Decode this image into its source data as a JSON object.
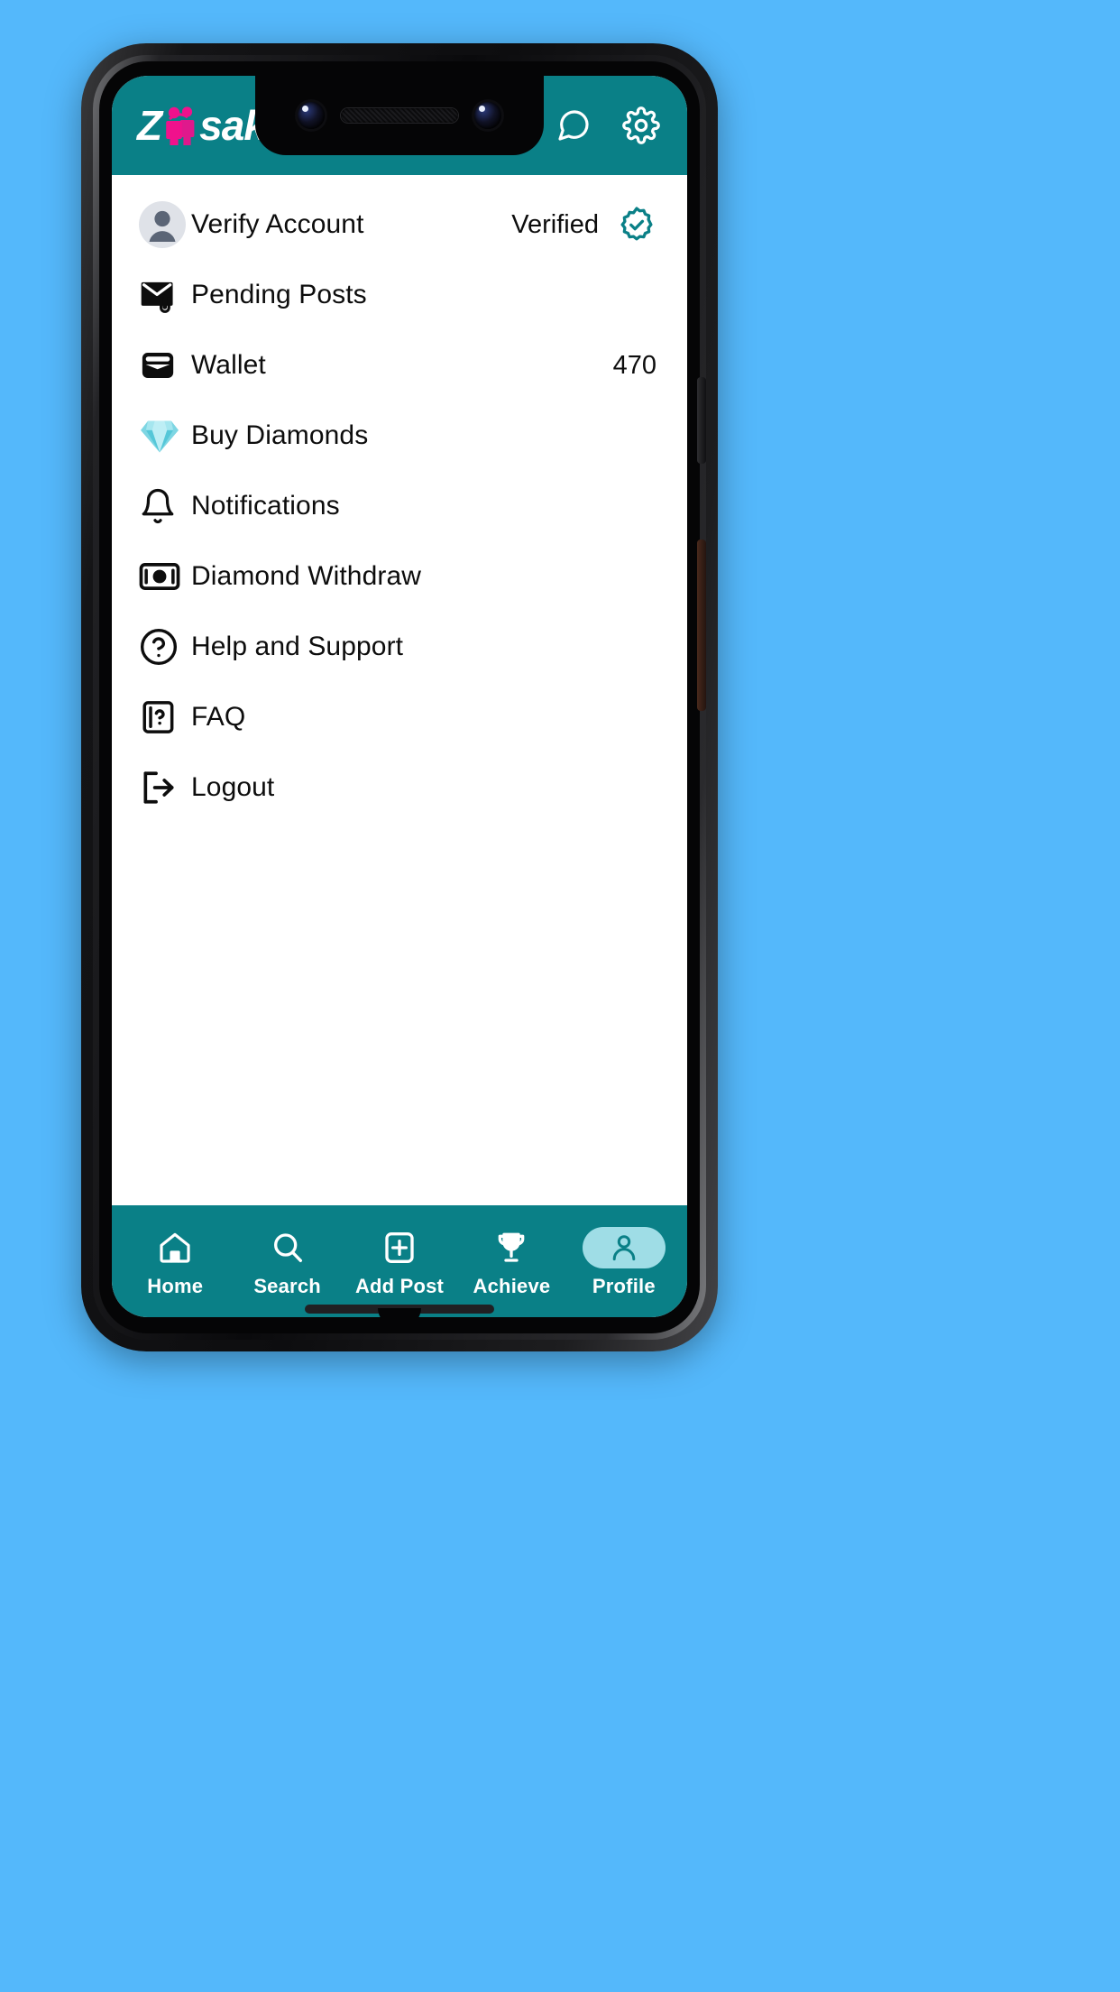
{
  "app": {
    "logo_prefix": "Z",
    "logo_suffix": "sakhi",
    "logo_icon": "couple-icon",
    "brand_teal": "#0a8087",
    "brand_pink": "#f0118c",
    "page_background": "#54b8fb"
  },
  "header": {
    "actions": [
      {
        "name": "notifications-bell-icon",
        "label": "Notifications"
      },
      {
        "name": "chat-bubble-icon",
        "label": "Messages"
      },
      {
        "name": "gear-icon",
        "label": "Settings"
      }
    ]
  },
  "menu": {
    "items": [
      {
        "icon": "avatar",
        "label": "Verify Account",
        "trailing_text": "Verified",
        "trailing_icon": "verified-badge-icon"
      },
      {
        "icon": "envelope-attachment-icon",
        "label": "Pending Posts",
        "trailing_text": "",
        "trailing_icon": ""
      },
      {
        "icon": "wallet-icon",
        "label": "Wallet",
        "trailing_text": "470",
        "trailing_icon": ""
      },
      {
        "icon": "diamond-icon",
        "label": "Buy Diamonds",
        "trailing_text": "",
        "trailing_icon": ""
      },
      {
        "icon": "bell-icon",
        "label": "Notifications",
        "trailing_text": "",
        "trailing_icon": ""
      },
      {
        "icon": "money-icon",
        "label": "Diamond Withdraw",
        "trailing_text": "",
        "trailing_icon": ""
      },
      {
        "icon": "question-circle-icon",
        "label": "Help and Support",
        "trailing_text": "",
        "trailing_icon": ""
      },
      {
        "icon": "faq-icon",
        "label": "FAQ",
        "trailing_text": "",
        "trailing_icon": ""
      },
      {
        "icon": "logout-icon",
        "label": "Logout",
        "trailing_text": "",
        "trailing_icon": ""
      }
    ]
  },
  "bottom_nav": {
    "active_index": 4,
    "active_pill_color": "#9fdde6",
    "items": [
      {
        "icon": "home-icon",
        "label": "Home"
      },
      {
        "icon": "search-icon",
        "label": "Search"
      },
      {
        "icon": "add-post-icon",
        "label": "Add Post"
      },
      {
        "icon": "trophy-icon",
        "label": "Achieve"
      },
      {
        "icon": "person-icon",
        "label": "Profile"
      }
    ]
  }
}
